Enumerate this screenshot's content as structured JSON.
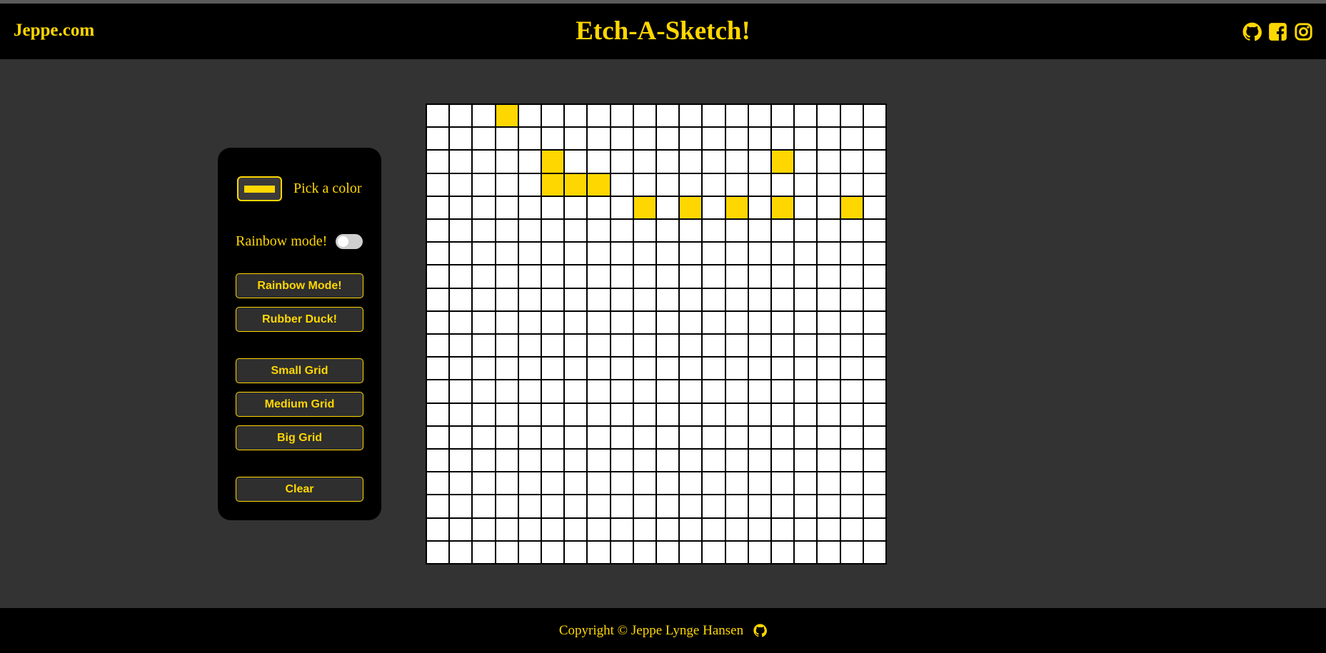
{
  "header": {
    "brand": "Jeppe.com",
    "title": "Etch-A-Sketch!",
    "social_icons": [
      "github-icon",
      "facebook-icon",
      "instagram-icon"
    ]
  },
  "controls": {
    "color_label": "Pick a color",
    "color_value": "#ffd700",
    "rainbow_toggle_label": "Rainbow mode!",
    "rainbow_toggle_on": false,
    "buttons": {
      "rainbow": "Rainbow Mode!",
      "rubber": "Rubber Duck!",
      "small": "Small Grid",
      "medium": "Medium Grid",
      "big": "Big Grid",
      "clear": "Clear"
    }
  },
  "grid": {
    "size": 20,
    "fill_color": "#ffd700",
    "filled_cells": [
      [
        0,
        3
      ],
      [
        2,
        5
      ],
      [
        2,
        15
      ],
      [
        3,
        5
      ],
      [
        3,
        6
      ],
      [
        3,
        7
      ],
      [
        4,
        9
      ],
      [
        4,
        11
      ],
      [
        4,
        13
      ],
      [
        4,
        15
      ],
      [
        4,
        18
      ]
    ]
  },
  "footer": {
    "copyright": "Copyright © Jeppe Lynge Hansen",
    "icon": "github-icon"
  },
  "colors": {
    "accent": "#ffd700",
    "background": "#333333",
    "bar": "#000000"
  }
}
